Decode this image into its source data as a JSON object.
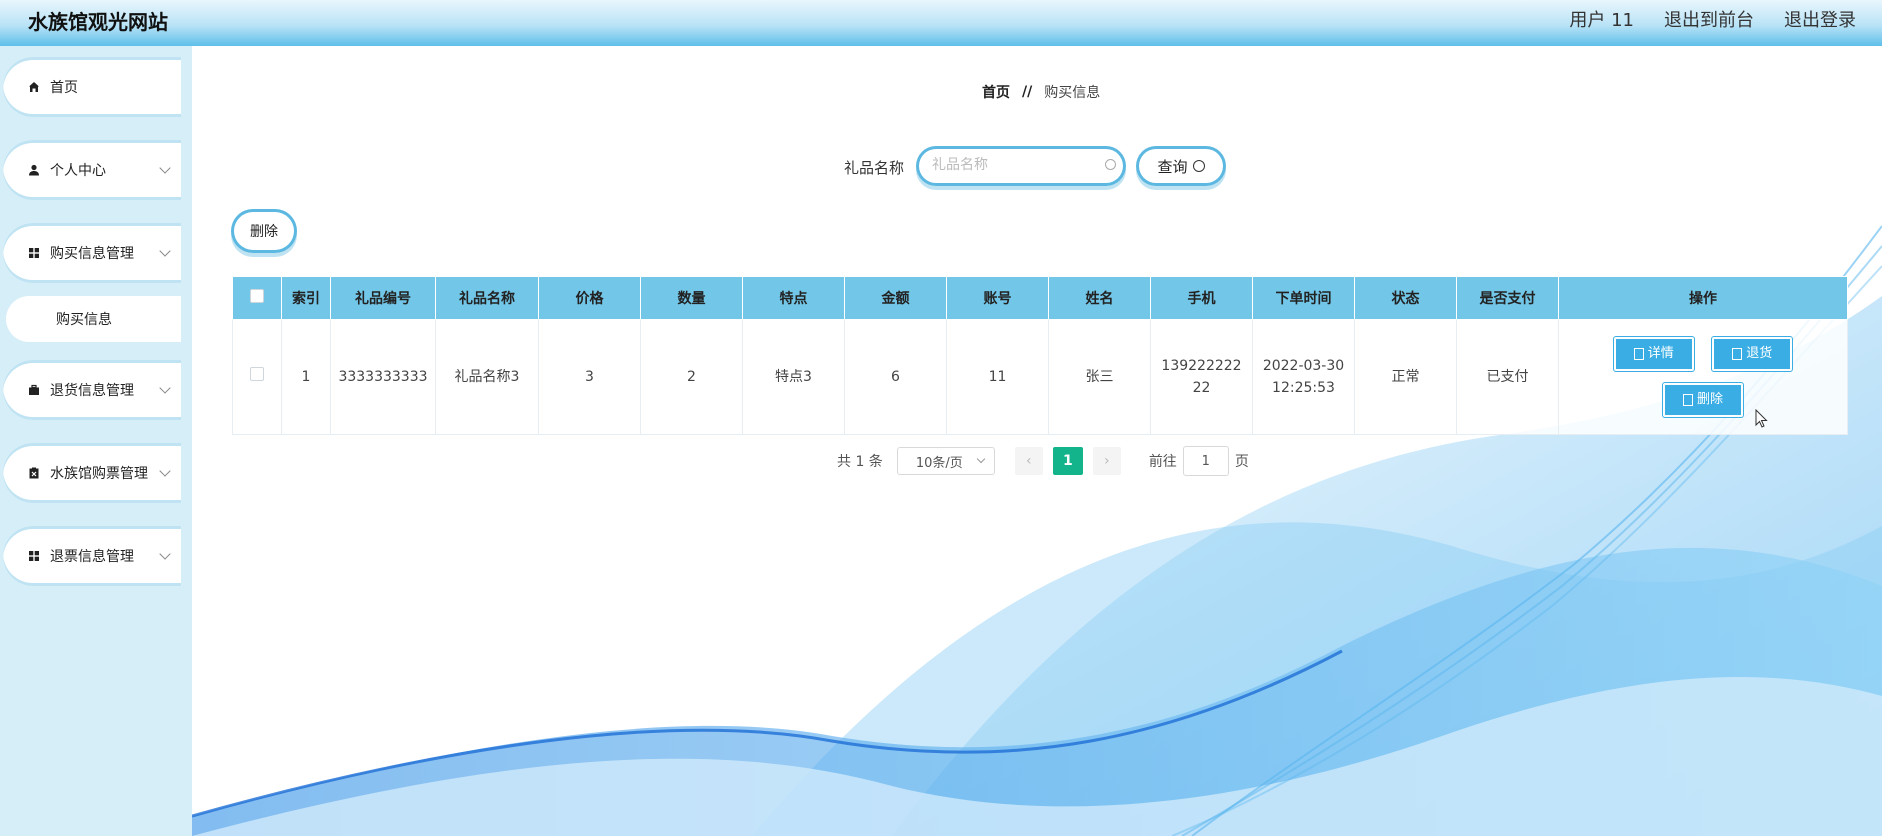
{
  "header": {
    "title": "水族馆观光网站",
    "user": "用户 11",
    "back_to_front": "退出到前台",
    "logout": "退出登录"
  },
  "sidebar": {
    "items": [
      {
        "label": "首页",
        "icon": "home-icon",
        "expandable": false
      },
      {
        "label": "个人中心",
        "icon": "user-icon",
        "expandable": true
      },
      {
        "label": "购买信息管理",
        "icon": "grid-icon",
        "expandable": true
      },
      {
        "label": "退货信息管理",
        "icon": "briefcase-icon",
        "expandable": true
      },
      {
        "label": "水族馆购票管理",
        "icon": "clipboard-icon",
        "expandable": true
      },
      {
        "label": "退票信息管理",
        "icon": "grid-icon",
        "expandable": true
      }
    ],
    "sub_item": "购买信息"
  },
  "breadcrumb": {
    "home": "首页",
    "separator": "//",
    "current": "购买信息"
  },
  "search": {
    "label": "礼品名称",
    "placeholder": "礼品名称",
    "value": "",
    "button": "查询"
  },
  "toolbar": {
    "delete": "删除"
  },
  "table": {
    "headers": [
      "索引",
      "礼品编号",
      "礼品名称",
      "价格",
      "数量",
      "特点",
      "金额",
      "账号",
      "姓名",
      "手机",
      "下单时间",
      "状态",
      "是否支付",
      "操作"
    ],
    "rows": [
      {
        "index": "1",
        "gift_no": "3333333333",
        "gift_name": "礼品名称3",
        "price": "3",
        "quantity": "2",
        "feature": "特点3",
        "amount": "6",
        "account": "11",
        "name": "张三",
        "phone_line1": "139222222",
        "phone_line2": "22",
        "order_date": "2022-03-30",
        "order_time": "12:25:53",
        "status": "正常",
        "paid": "已支付",
        "actions": {
          "detail": "详情",
          "return": "退货",
          "delete": "删除"
        }
      }
    ]
  },
  "pagination": {
    "total": "共 1 条",
    "page_size": "10条/页",
    "current_page": "1",
    "goto_label": "前往",
    "goto_value": "1",
    "page_suffix": "页"
  },
  "colors": {
    "header_accent": "#5fbfea",
    "table_header": "#72c6e7",
    "action_button": "#3aaee4",
    "active_page": "#13b38b",
    "sidebar_bg": "#d6eef8"
  }
}
